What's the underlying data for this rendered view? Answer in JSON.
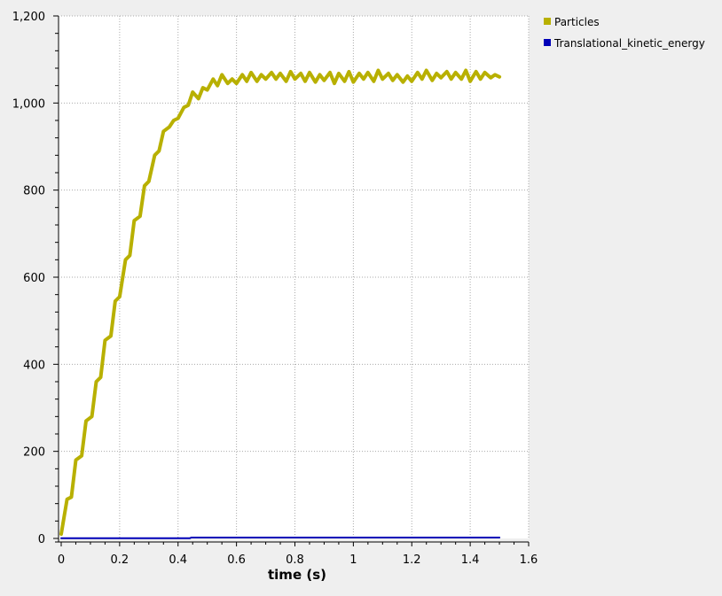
{
  "chart_data": {
    "type": "line",
    "xlabel": "time (s)",
    "ylabel": "",
    "xlim": [
      0,
      1.6
    ],
    "ylim": [
      0,
      1200
    ],
    "x_ticks": [
      0,
      0.2,
      0.4,
      0.6,
      0.8,
      1,
      1.2,
      1.4,
      1.6
    ],
    "x_tick_labels": [
      "0",
      "0.2",
      "0.4",
      "0.6",
      "0.8",
      "1",
      "1.2",
      "1.4",
      "1.6"
    ],
    "y_ticks": [
      0,
      200,
      400,
      600,
      800,
      1000,
      1200
    ],
    "y_tick_labels": [
      "0",
      "200",
      "400",
      "600",
      "800",
      "1,000",
      "1,200"
    ],
    "grid": true,
    "legend_position": "right",
    "series": [
      {
        "name": "Particles",
        "color": "#b8b000",
        "x": [
          0,
          0.01,
          0.02,
          0.035,
          0.05,
          0.07,
          0.085,
          0.105,
          0.12,
          0.135,
          0.15,
          0.17,
          0.185,
          0.2,
          0.22,
          0.235,
          0.25,
          0.27,
          0.285,
          0.3,
          0.32,
          0.335,
          0.35,
          0.37,
          0.385,
          0.4,
          0.42,
          0.435,
          0.45,
          0.47,
          0.485,
          0.5,
          0.52,
          0.535,
          0.55,
          0.57,
          0.585,
          0.6,
          0.62,
          0.635,
          0.65,
          0.67,
          0.685,
          0.7,
          0.72,
          0.735,
          0.75,
          0.77,
          0.785,
          0.8,
          0.82,
          0.835,
          0.85,
          0.87,
          0.885,
          0.9,
          0.92,
          0.935,
          0.95,
          0.97,
          0.985,
          1.0,
          1.02,
          1.035,
          1.05,
          1.07,
          1.085,
          1.1,
          1.12,
          1.135,
          1.15,
          1.17,
          1.185,
          1.2,
          1.22,
          1.235,
          1.25,
          1.27,
          1.285,
          1.3,
          1.32,
          1.335,
          1.35,
          1.37,
          1.385,
          1.4,
          1.42,
          1.435,
          1.45,
          1.47,
          1.485,
          1.5
        ],
        "values": [
          10,
          50,
          90,
          95,
          180,
          190,
          270,
          280,
          360,
          370,
          455,
          465,
          545,
          555,
          640,
          650,
          730,
          740,
          810,
          820,
          880,
          890,
          935,
          945,
          960,
          965,
          990,
          995,
          1025,
          1010,
          1035,
          1030,
          1055,
          1040,
          1065,
          1045,
          1055,
          1045,
          1065,
          1050,
          1070,
          1050,
          1065,
          1055,
          1070,
          1055,
          1068,
          1050,
          1072,
          1055,
          1068,
          1050,
          1070,
          1048,
          1065,
          1052,
          1070,
          1045,
          1068,
          1050,
          1072,
          1048,
          1068,
          1055,
          1070,
          1050,
          1075,
          1055,
          1068,
          1052,
          1065,
          1048,
          1062,
          1050,
          1070,
          1055,
          1075,
          1052,
          1068,
          1058,
          1072,
          1055,
          1070,
          1055,
          1075,
          1050,
          1072,
          1055,
          1070,
          1058,
          1065,
          1060
        ]
      },
      {
        "name": "Translational_kinetic_energy",
        "color": "#0000b8",
        "x": [
          0,
          0.44,
          0.445,
          1.5
        ],
        "values": [
          0.5,
          0.5,
          2,
          2
        ]
      }
    ]
  }
}
